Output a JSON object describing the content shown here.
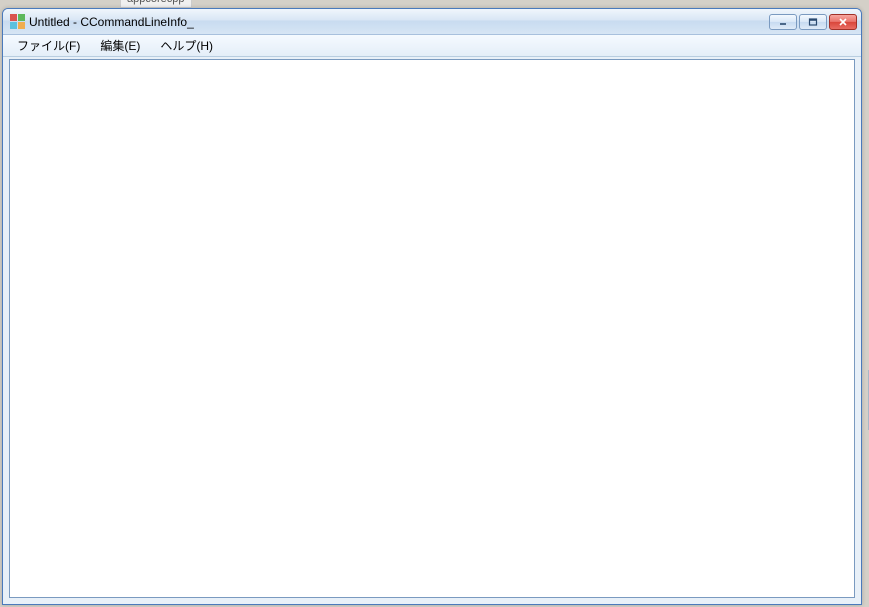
{
  "background_hint": "appcorecpp",
  "window": {
    "title": "Untitled - CCommandLineInfo_"
  },
  "menu": {
    "file": "ファイル(F)",
    "edit": "編集(E)",
    "help": "ヘルプ(H)"
  }
}
